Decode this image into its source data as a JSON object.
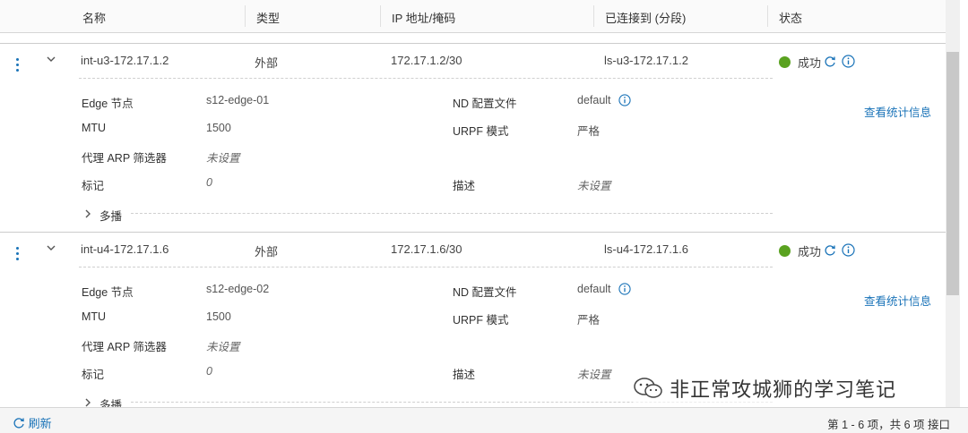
{
  "columns": [
    "名称",
    "类型",
    "IP 地址/掩码",
    "已连接到 (分段)",
    "状态"
  ],
  "rows": [
    {
      "name": "int-u3-172.17.1.2",
      "type": "外部",
      "ip": "172.17.1.2/30",
      "connected": "ls-u3-172.17.1.2",
      "status": "成功",
      "details": {
        "edge_label": "Edge 节点",
        "edge_value": "s12-edge-01",
        "mtu_label": "MTU",
        "mtu_value": "1500",
        "arp_label": "代理 ARP 筛选器",
        "arp_value": "未设置",
        "tag_label": "标记",
        "tag_value": "0",
        "nd_label": "ND 配置文件",
        "nd_value": "default",
        "urpf_label": "URPF 模式",
        "urpf_value": "严格",
        "desc_label": "描述",
        "desc_value": "未设置",
        "stats_link": "查看统计信息",
        "multicast": "多播"
      }
    },
    {
      "name": "int-u4-172.17.1.6",
      "type": "外部",
      "ip": "172.17.1.6/30",
      "connected": "ls-u4-172.17.1.6",
      "status": "成功",
      "details": {
        "edge_label": "Edge 节点",
        "edge_value": "s12-edge-02",
        "mtu_label": "MTU",
        "mtu_value": "1500",
        "arp_label": "代理 ARP 筛选器",
        "arp_value": "未设置",
        "tag_label": "标记",
        "tag_value": "0",
        "nd_label": "ND 配置文件",
        "nd_value": "default",
        "urpf_label": "URPF 模式",
        "urpf_value": "严格",
        "desc_label": "描述",
        "desc_value": "未设置",
        "stats_link": "查看统计信息",
        "multicast": "多播"
      }
    }
  ],
  "footer": {
    "refresh_label": "刷新",
    "pagination": "第 1 - 6 项，共 6 项 接口"
  },
  "watermark": "非正常攻城狮的学习笔记",
  "colors": {
    "accent": "#1a73b8",
    "success": "#5aa220"
  }
}
